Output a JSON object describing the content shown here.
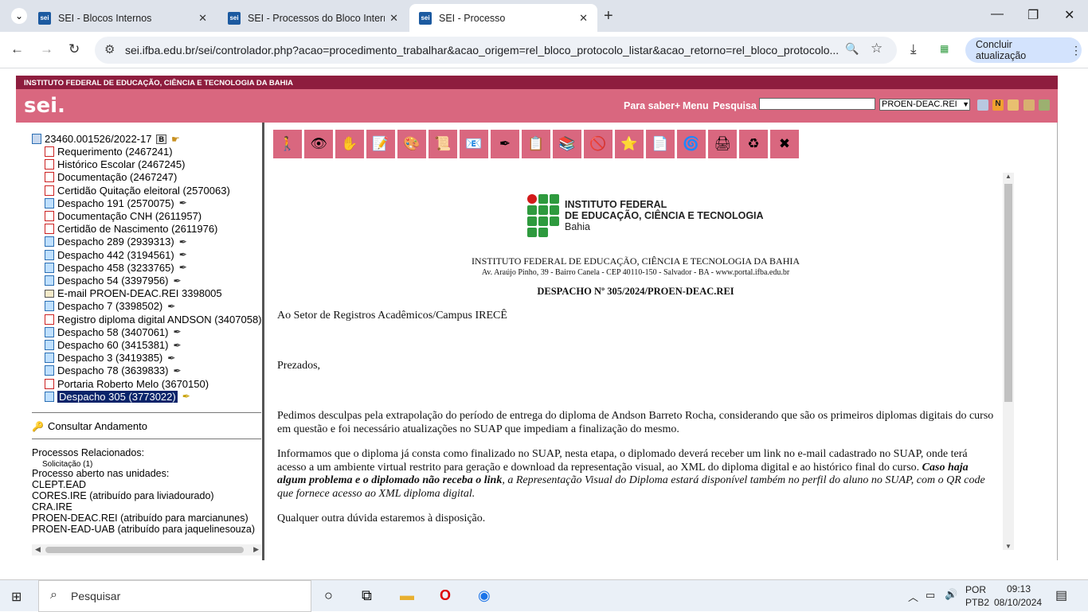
{
  "browser": {
    "tabs": [
      {
        "title": "SEI - Blocos Internos",
        "favicon": "sei"
      },
      {
        "title": "SEI - Processos do Bloco Interno",
        "favicon": "sei"
      },
      {
        "title": "SEI - Processo",
        "favicon": "sei"
      }
    ],
    "url": "sei.ifba.edu.br/sei/controlador.php?acao=procedimento_trabalhar&acao_origem=rel_bloco_protocolo_listar&acao_retorno=rel_bloco_protocolo...",
    "update_button": "Concluir atualização"
  },
  "header": {
    "institution": "INSTITUTO FEDERAL DE EDUCAÇÃO, CIÊNCIA E TECNOLOGIA DA BAHIA",
    "logo": "sei.",
    "links": [
      "Para saber+",
      "Menu",
      "Pesquisa"
    ],
    "unit_select": "PROEN-DEAC.REI",
    "accent_color": "#d9677f",
    "banner_color": "#8e1d3e"
  },
  "tree": {
    "process_number": "23460.001526/2022-17",
    "documents": [
      {
        "label": "Requerimento (2467241)",
        "type": "pdf"
      },
      {
        "label": "Histórico Escolar (2467245)",
        "type": "pdf"
      },
      {
        "label": "Documentação (2467247)",
        "type": "pdf"
      },
      {
        "label": "Certidão Quitação eleitoral (2570063)",
        "type": "pdf"
      },
      {
        "label": "Despacho 191 (2570075)",
        "type": "doc",
        "signed": true
      },
      {
        "label": "Documentação CNH (2611957)",
        "type": "pdf"
      },
      {
        "label": "Certidão de Nascimento (2611976)",
        "type": "pdf"
      },
      {
        "label": "Despacho 289 (2939313)",
        "type": "doc",
        "signed": true
      },
      {
        "label": "Despacho 442 (3194561)",
        "type": "doc",
        "signed": true
      },
      {
        "label": "Despacho 458 (3233765)",
        "type": "doc",
        "signed": true
      },
      {
        "label": "Despacho 54 (3397956)",
        "type": "doc",
        "signed": true
      },
      {
        "label": "E-mail PROEN-DEAC.REI 3398005",
        "type": "mail"
      },
      {
        "label": "Despacho 7 (3398502)",
        "type": "doc",
        "signed": true
      },
      {
        "label": "Registro diploma digital ANDSON (3407058)",
        "type": "pdf"
      },
      {
        "label": "Despacho 58 (3407061)",
        "type": "doc",
        "signed": true
      },
      {
        "label": "Despacho 60 (3415381)",
        "type": "doc",
        "signed": true
      },
      {
        "label": "Despacho 3 (3419385)",
        "type": "doc",
        "signed": true
      },
      {
        "label": "Despacho 78 (3639833)",
        "type": "doc",
        "signed": true
      },
      {
        "label": "Portaria Roberto Melo (3670150)",
        "type": "pdf"
      },
      {
        "label": "Despacho 305 (3773022)",
        "type": "doc",
        "selected": true
      }
    ],
    "consult_link": "Consultar Andamento",
    "related_title": "Processos Relacionados:",
    "related_item": "Solicitação (1)",
    "open_units_title": "Processo aberto nas unidades:",
    "units": [
      "CLEPT.EAD",
      "CORES.IRE (atribuído para liviadourado)",
      "CRA.IRE",
      "PROEN-DEAC.REI (atribuído para marcianunes)",
      "PROEN-EAD-UAB (atribuído para jaquelinesouza)"
    ]
  },
  "document": {
    "logo_lines": [
      "INSTITUTO FEDERAL",
      "DE EDUCAÇÃO, CIÊNCIA E TECNOLOGIA",
      "Bahia"
    ],
    "inst_name": "INSTITUTO FEDERAL DE EDUCAÇÃO, CIÊNCIA E TECNOLOGIA DA BAHIA",
    "address": "Av. Araújo Pinho, 39 - Bairro Canela - CEP 40110-150 - Salvador - BA - www.portal.ifba.edu.br",
    "title": "DESPACHO Nº 305/2024/PROEN-DEAC.REI",
    "to": "Ao Setor de Registros Acadêmicos/Campus IRECÊ",
    "greeting": "Prezados,",
    "para1": "Pedimos desculpas pela extrapolação do período de entrega do diploma de Andson Barreto Rocha, considerando que são os primeiros diplomas digitais do curso em questão e foi necessário atualizações no SUAP que impediam a finalização do mesmo.",
    "para2a": "Informamos que o diploma já consta como finalizado no SUAP, nesta etapa, o diplomado deverá receber um link no e-mail cadastrado no SUAP, onde terá acesso a um ambiente virtual restrito para geração e download da representação visual, ao XML do diploma digital e ao histórico final do curso. ",
    "para2b": "Caso haja algum problema e o diplomado não receba o link",
    "para2c": ", a Representação Visual do Diploma estará disponível também no perfil do aluno no SUAP, com o QR code que fornece acesso ao XML diploma digital.",
    "para3": "Qualquer outra dúvida estaremos à disposição."
  },
  "taskbar": {
    "search_placeholder": "Pesquisar",
    "lang1": "POR",
    "lang2": "PTB2",
    "time": "09:13",
    "date": "08/10/2024"
  }
}
